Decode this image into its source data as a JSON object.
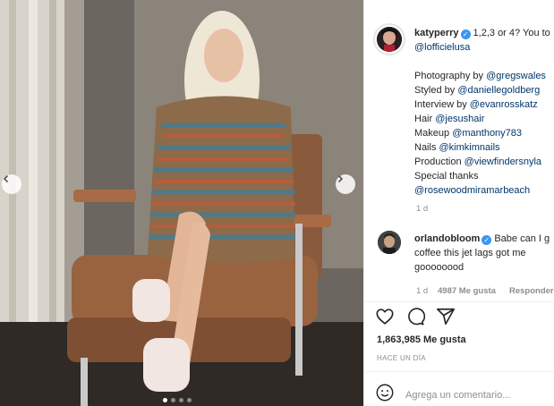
{
  "post": {
    "author": "katyperry",
    "caption_lines": [
      "1,2,3 or 4? You to",
      "@lofficielusa",
      "",
      "Photography by @gregswales",
      "Styled by @daniellegoldberg",
      "Interview by @evanrosskatz",
      "Hair @jesushair",
      "Makeup @manthony783",
      "Nails @kimkimnails",
      "Production @viewfindersnyla",
      "Special thanks",
      "@rosewoodmiramarbeach"
    ],
    "caption_age": "1 d"
  },
  "comment": {
    "author": "orlandobloom",
    "lines": [
      "Babe can I g",
      "coffee this jet lags got me",
      "goooooood"
    ],
    "age": "1 d",
    "likes": "4987 Me gusta",
    "reply": "Responder"
  },
  "likes": {
    "count": "1,863,985",
    "label": "Me gusta"
  },
  "posted": "HACE UN DÍA",
  "add_comment": {
    "placeholder": "Agrega un comentario..."
  },
  "icons": {
    "nav_left": "chevron-left-icon",
    "nav_right": "chevron-right-icon",
    "verified": "verified-badge-icon",
    "like": "heart-icon",
    "comment": "comment-icon",
    "share": "share-icon",
    "emoji": "emoji-icon"
  },
  "colors": {
    "verified": "#3897f0",
    "link": "#00376b",
    "muted": "#8e8e8e"
  },
  "carousel": {
    "slides": 4,
    "active_slide": 1
  }
}
